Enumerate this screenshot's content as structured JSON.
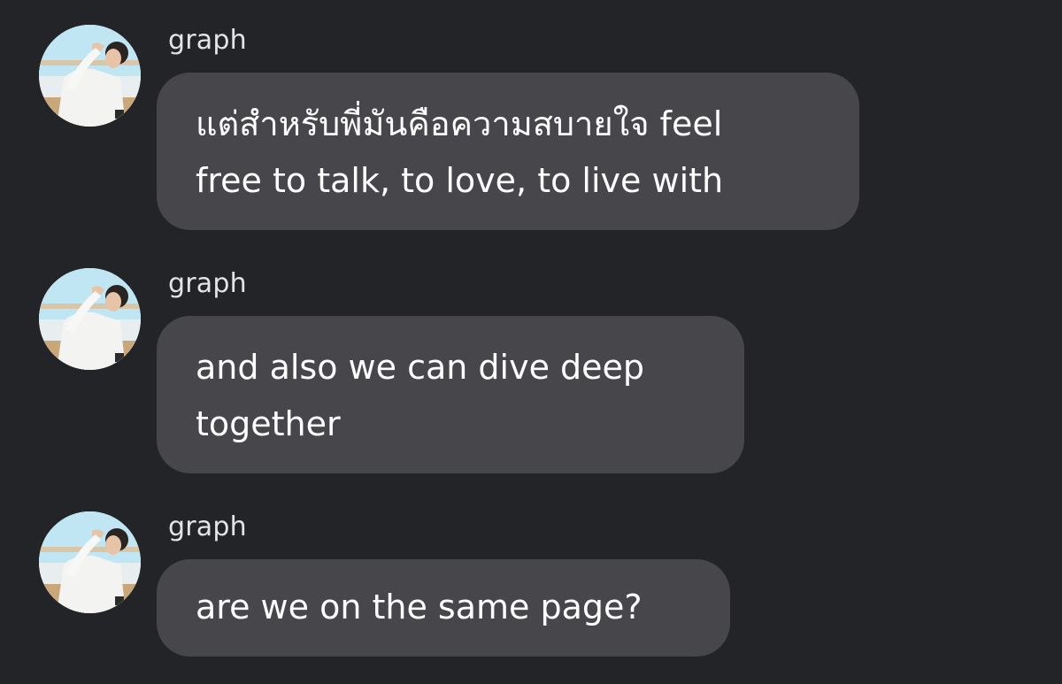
{
  "messages": [
    {
      "sender": "graph",
      "avatar_icon": "profile-photo",
      "lines": [
        "แต่สำหรับพี่มันคือความสบายใจ feel",
        "free to talk, to love, to live with"
      ]
    },
    {
      "sender": "graph",
      "avatar_icon": "profile-photo",
      "lines": [
        "and also we can dive deep",
        "together"
      ]
    },
    {
      "sender": "graph",
      "avatar_icon": "profile-photo",
      "lines": [
        "are we on the same page?"
      ]
    }
  ],
  "colors": {
    "background": "#232428",
    "bubble": "#47474b",
    "text": "#ffffff",
    "sender": "#e4e4e6"
  }
}
